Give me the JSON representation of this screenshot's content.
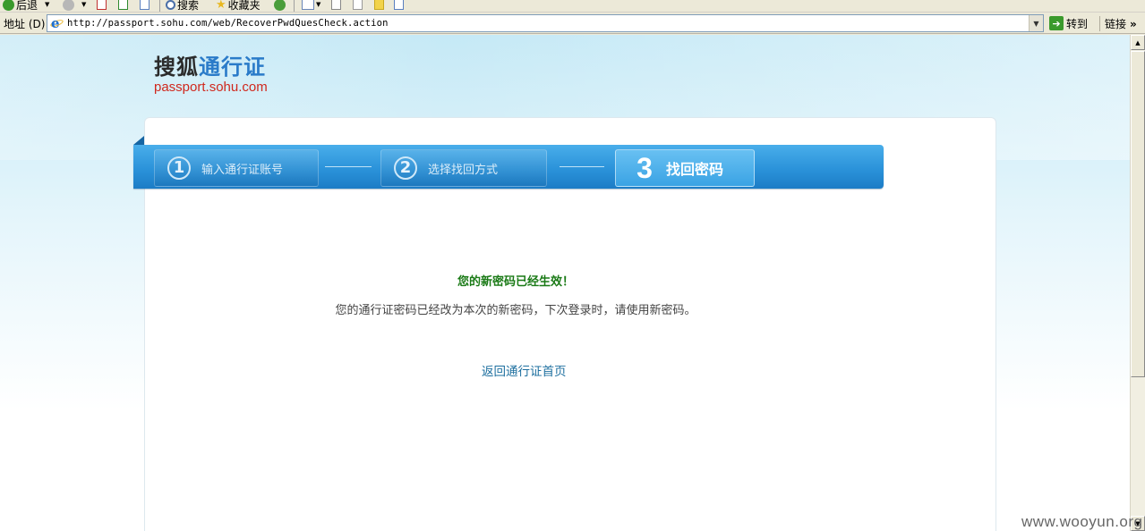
{
  "toolbar": {
    "back_label": "后退",
    "search_label": "搜索",
    "favorites_label": "收藏夹"
  },
  "addressbar": {
    "label": "地址 (D)",
    "url": "http://passport.sohu.com/web/RecoverPwdQuesCheck.action",
    "go_label": "转到",
    "links_label": "链接",
    "links_more": "»"
  },
  "logo": {
    "cn_part1": "搜狐",
    "cn_part2": "通行证",
    "en": "passport.sohu.com"
  },
  "steps": [
    {
      "number": "①",
      "label": "输入通行证账号",
      "active": false
    },
    {
      "number": "②",
      "label": "选择找回方式",
      "active": false
    },
    {
      "number": "3",
      "label": "找回密码",
      "active": true
    }
  ],
  "message": {
    "title": "您的新密码已经生效！",
    "description": "您的通行证密码已经改为本次的新密码，下次登录时，请使用新密码。",
    "back_link": "返回通行证首页"
  },
  "watermark": "www.wooyun.org",
  "colors": {
    "success_green": "#1a7a16",
    "link_blue": "#1d6f9f",
    "step_bar_blue": "#2b93da",
    "logo_red": "#d0281d"
  }
}
